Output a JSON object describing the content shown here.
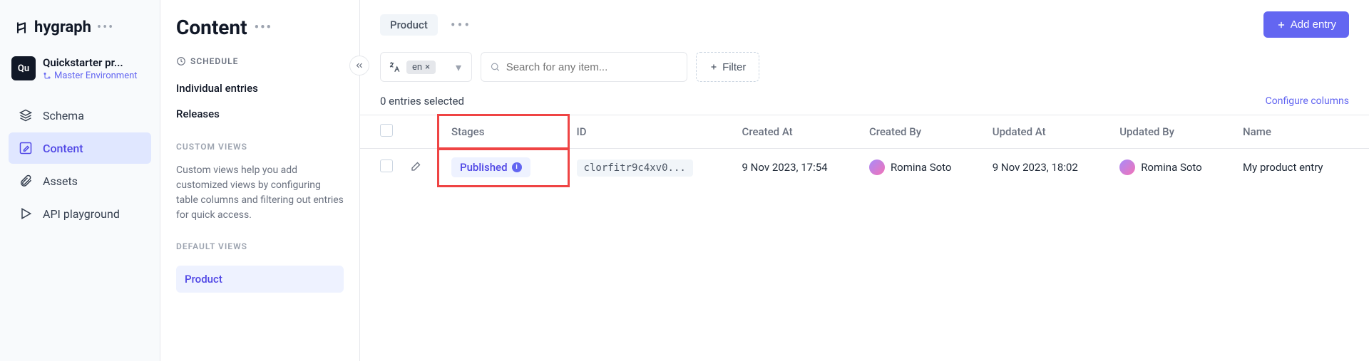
{
  "brand": {
    "name": "hygraph"
  },
  "project": {
    "avatar": "Qu",
    "name": "Quickstarter pr...",
    "env": "Master Environment"
  },
  "nav": {
    "schema": "Schema",
    "content": "Content",
    "assets": "Assets",
    "api": "API playground"
  },
  "mid": {
    "title": "Content",
    "schedule_label": "SCHEDULE",
    "individual": "Individual entries",
    "releases": "Releases",
    "custom_label": "CUSTOM VIEWS",
    "custom_desc": "Custom views help you add customized views by configuring table columns and filtering out entries for quick access.",
    "default_label": "DEFAULT VIEWS",
    "product_view": "Product"
  },
  "topbar": {
    "crumb": "Product",
    "add_entry": "Add entry"
  },
  "toolbar": {
    "locale": "en",
    "search_placeholder": "Search for any item...",
    "filter": "Filter"
  },
  "table": {
    "selected_text": "0 entries selected",
    "configure": "Configure columns",
    "cols": {
      "stages": "Stages",
      "id": "ID",
      "created_at": "Created At",
      "created_by": "Created By",
      "updated_at": "Updated At",
      "updated_by": "Updated By",
      "name": "Name"
    },
    "row": {
      "stage": "Published",
      "id": "clorfitr9c4xv0...",
      "created_at": "9 Nov 2023, 17:54",
      "created_by": "Romina Soto",
      "updated_at": "9 Nov 2023, 18:02",
      "updated_by": "Romina Soto",
      "name": "My product entry"
    }
  }
}
